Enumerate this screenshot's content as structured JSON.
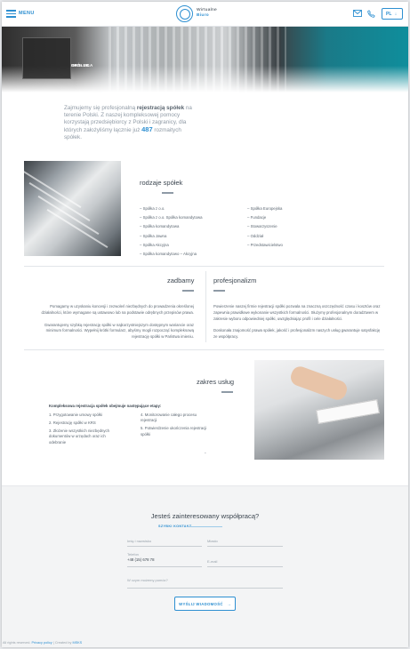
{
  "header": {
    "menu_label": "MENU",
    "logo_line1": "Wirtualne",
    "logo_line2": "Biuro",
    "lang": "PL"
  },
  "hero": {
    "label_line1": "OBSŁUGA",
    "label_line2": "SPÓŁEK"
  },
  "intro": {
    "pre": "Zajmujemy się profesjonalną ",
    "bold": "rejestracją spółek",
    "mid": " na terenie Polski. Z naszej kompleksowej pomocy korzystają przedsiębiorcy z Polski i zagranicy, dla których założyliśmy łącznie już ",
    "number": "487",
    "post": " rozmaitych spółek."
  },
  "types": {
    "title": "rodzaje spółek",
    "left": [
      "– Spółka z o.o.",
      "– Spółka z o.o. Spółka komandytowa",
      "– Spółka komandytowa",
      "– Spółka Jawna",
      "– Spółka Akcyjna",
      "– Spółka komandytowo – Akcyjna"
    ],
    "right": [
      "– Spółka Europejska",
      "– Fundacje",
      "– Stowarzyszenie",
      "– Oddział",
      "– Przedstawicielstwo"
    ]
  },
  "dbamy": {
    "title": "zadbamy",
    "p1": "Pomagamy w uzyskaniu koncesji i zezwoleń niezbędnych do prowadzenia określonej działalności, które wymagane są ustawowo lub na podstawie odrębnych przepisów prawa.",
    "p2": "Gwarantujemy szybką rejestrację spółki w najkorzystniejszym dostępnym wariancie oraz minimum formalności. Wypełnij krótki formularz, abyśmy mogli rozpocząć kompleksową rejestrację spółki w Państwa imieniu."
  },
  "profesjonalizm": {
    "title": "profesjonalizm",
    "p1": "Powierzenie naszej firmie rejestracji spółki pozwala na znaczną oszczędność czasu i kosztów oraz zapewnia prawidłowe wykonanie wszystkich formalności. Służymy profesjonalnym doradztwem w zakresie wyboru odpowiedniej spółki, uwzględniając profil i cele działalności.",
    "p2": "Doskonała znajomość prawa spółek, jakość i profesjonalizm naszych usług gwarantuje satysfakcję ze współpracy."
  },
  "zakres": {
    "title": "zakres usług",
    "intro": "Kompleksowa rejestracja spółek obejmuje następujące etapy:",
    "left": [
      "1. Przygotowanie umowy spółki",
      "2. Rejestrację spółki w KRS",
      "3. Złożenie wszystkich niezbędnych dokumentów w urzędach oraz ich odebranie"
    ],
    "right": [
      "4. Monitorowanie całego procesu rejestracji",
      "5. Potwierdzenie ukończenia rejestracji spółki"
    ],
    "dash": "-"
  },
  "contact": {
    "title": "Jesteś zainteresowany współpracą?",
    "subtitle": "SZYBKI KONTAKT",
    "name_label": "Imię i nazwisko",
    "city_label": "Miasto",
    "phone_label": "Telefon",
    "phone_value": "+48 (15) 678 78",
    "email_label": "E-mail",
    "message_label": "W czym możemy pomóc?",
    "submit": "WYŚLIJ WIADOMOŚĆ",
    "submit_arrow": "→"
  },
  "footer": {
    "rights": "All rights reserved. ",
    "privacy": "Privacy policy",
    "sep": " | Created by ",
    "creator": "MSKS"
  },
  "colors": {
    "accent": "#2d8fd1",
    "text": "#4a5560"
  }
}
